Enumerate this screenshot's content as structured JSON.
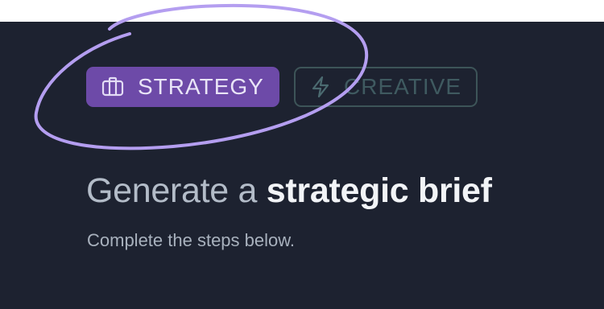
{
  "tabs": [
    {
      "label": "STRATEGY",
      "icon": "briefcase-icon",
      "selected": true
    },
    {
      "label": "CREATIVE",
      "icon": "lightning-icon",
      "selected": false
    }
  ],
  "heading": {
    "lead": "Generate a ",
    "emphasis": "strategic brief"
  },
  "subtitle": "Complete the steps below.",
  "colors": {
    "panel_background": "#1d2230",
    "selected_tab": "#6d4aa8",
    "unselected_tab_border": "#3d5458",
    "annotation_stroke": "#b49ef0"
  }
}
